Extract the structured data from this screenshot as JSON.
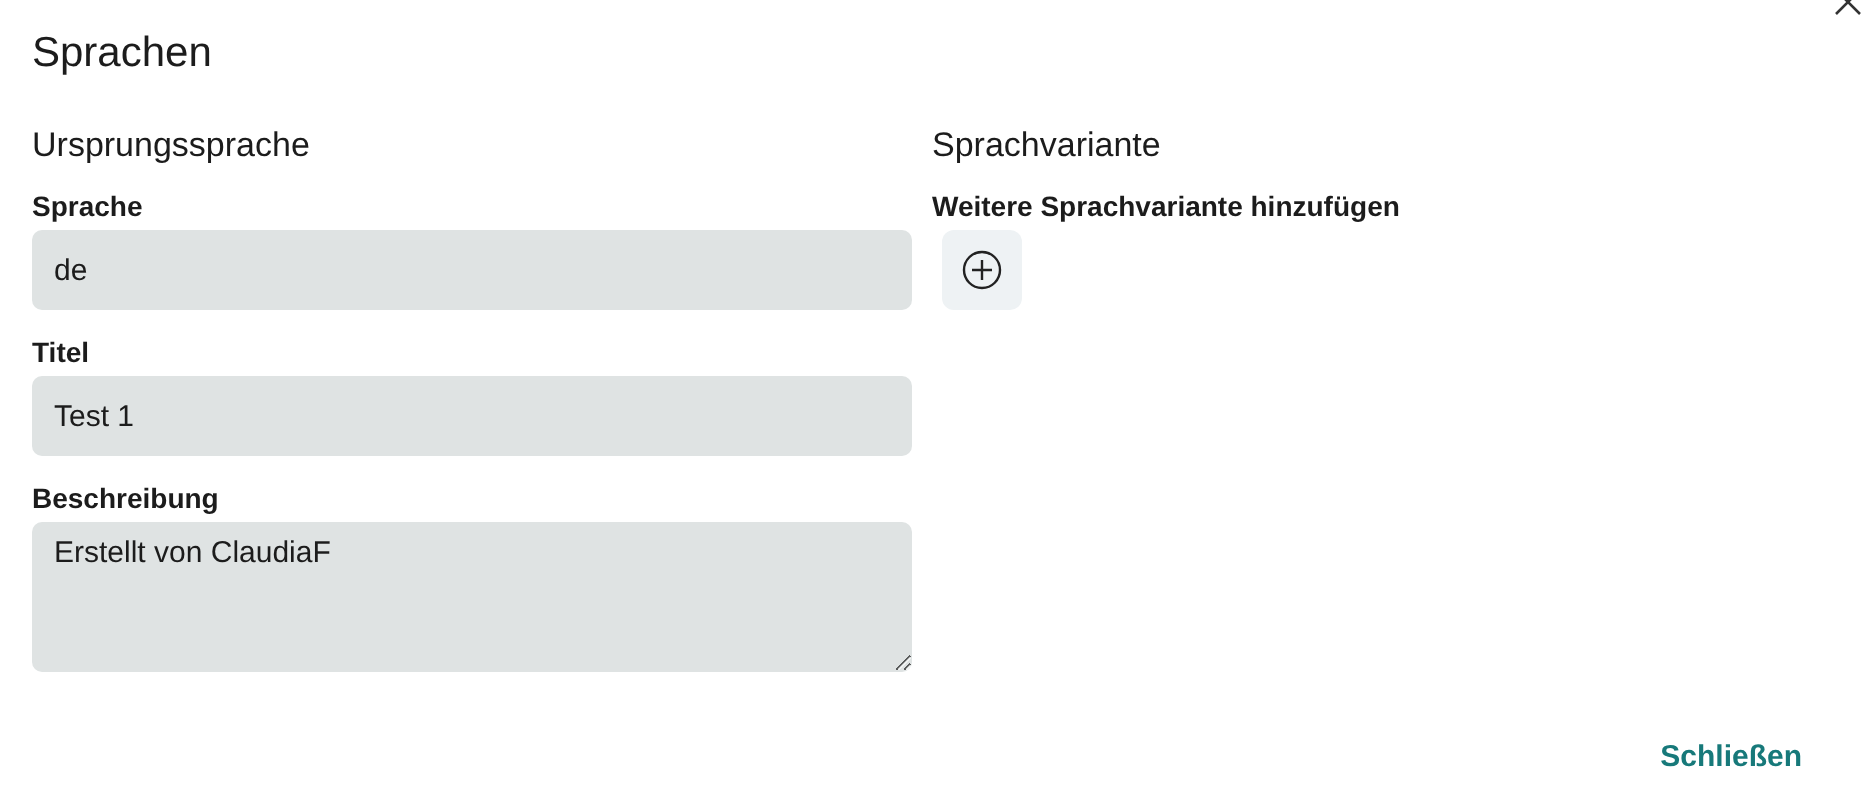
{
  "dialog": {
    "title": "Sprachen"
  },
  "origin": {
    "heading": "Ursprungssprache",
    "fields": [
      {
        "label": "Sprache",
        "value": "de",
        "kind": "input"
      },
      {
        "label": "Titel",
        "value": "Test 1",
        "kind": "input"
      },
      {
        "label": "Beschreibung",
        "value": "Erstellt von ClaudiaF",
        "kind": "textarea"
      }
    ]
  },
  "variant": {
    "heading": "Sprachvariante",
    "add_label": "Weitere Sprachvariante hinzufügen"
  },
  "buttons": [
    "Schließen"
  ]
}
